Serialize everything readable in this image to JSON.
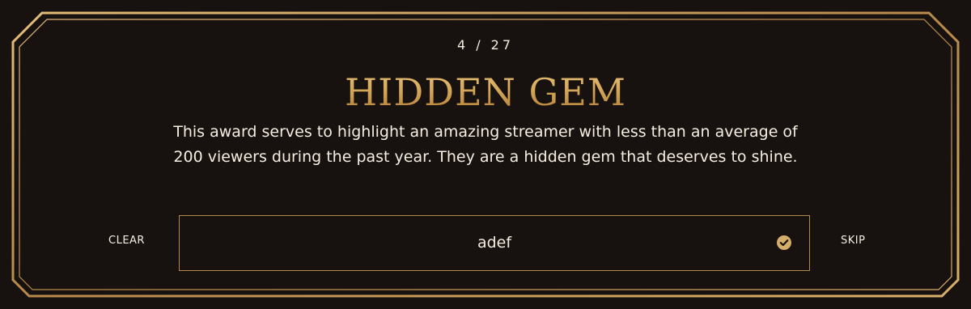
{
  "award": {
    "counter": "4 / 27",
    "title": "HIDDEN GEM",
    "description": "This award serves to highlight an amazing streamer with less than an average of 200 viewers during the past year. They are a hidden gem that deserves to shine."
  },
  "actions": {
    "clear_label": "CLEAR",
    "skip_label": "SKIP"
  },
  "vote": {
    "value": "adef",
    "status_icon": "check-circle-icon"
  },
  "colors": {
    "background": "#17120f",
    "gold": "#c9a062",
    "text": "#f4ede0"
  }
}
